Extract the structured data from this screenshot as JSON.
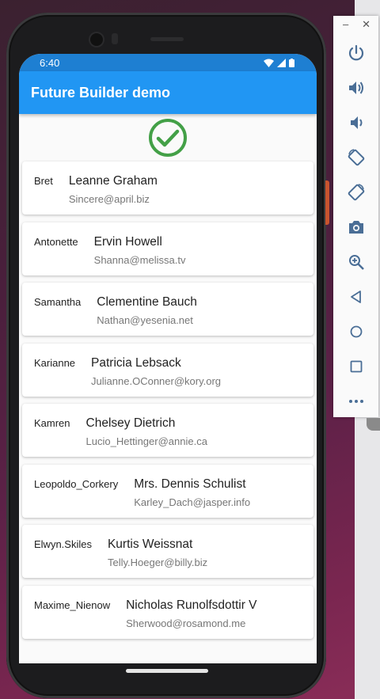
{
  "status_bar": {
    "time": "6:40"
  },
  "app_bar": {
    "title": "Future Builder demo"
  },
  "users": [
    {
      "username": "Bret",
      "name": "Leanne Graham",
      "email": "Sincere@april.biz"
    },
    {
      "username": "Antonette",
      "name": "Ervin Howell",
      "email": "Shanna@melissa.tv"
    },
    {
      "username": "Samantha",
      "name": "Clementine Bauch",
      "email": "Nathan@yesenia.net"
    },
    {
      "username": "Karianne",
      "name": "Patricia Lebsack",
      "email": "Julianne.OConner@kory.org"
    },
    {
      "username": "Kamren",
      "name": "Chelsey Dietrich",
      "email": "Lucio_Hettinger@annie.ca"
    },
    {
      "username": "Leopoldo_Corkery",
      "name": "Mrs. Dennis Schulist",
      "email": "Karley_Dach@jasper.info"
    },
    {
      "username": "Elwyn.Skiles",
      "name": "Kurtis Weissnat",
      "email": "Telly.Hoeger@billy.biz"
    },
    {
      "username": "Maxime_Nienow",
      "name": "Nicholas Runolfsdottir V",
      "email": "Sherwood@rosamond.me"
    }
  ],
  "emulator_toolbar": {
    "minimize_label": "–",
    "close_label": "✕",
    "buttons": [
      {
        "icon": "power-icon"
      },
      {
        "icon": "volume-up-icon"
      },
      {
        "icon": "volume-down-icon"
      },
      {
        "icon": "rotate-left-icon"
      },
      {
        "icon": "rotate-right-icon"
      },
      {
        "icon": "camera-icon"
      },
      {
        "icon": "zoom-icon"
      },
      {
        "icon": "back-icon"
      },
      {
        "icon": "home-icon"
      },
      {
        "icon": "overview-icon"
      },
      {
        "icon": "more-icon"
      }
    ]
  },
  "colors": {
    "app_bar": "#2196f3",
    "status_bar": "#1e7fd2",
    "check": "#43a047"
  }
}
